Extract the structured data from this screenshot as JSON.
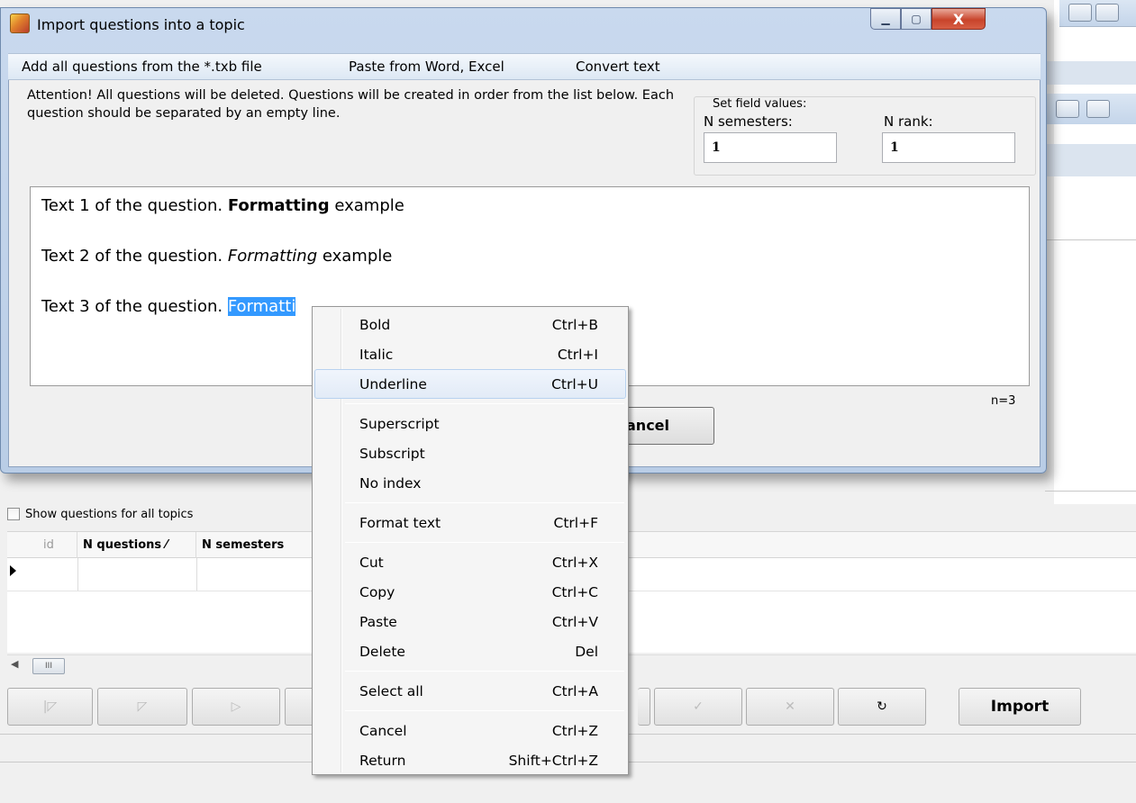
{
  "dialog": {
    "title": "Import questions into a topic",
    "close_label": "X",
    "menu": [
      "Add all questions from the *.txb file",
      "Paste from Word, Excel",
      "Convert text"
    ],
    "attention_text": "Attention! All questions will be deleted. Questions will be created in order from the list below. Each question should be separated by an empty line.",
    "field_values": {
      "legend": "Set field values:",
      "semesters_label": "N semesters:",
      "semesters_value": "1",
      "rank_label": "N rank:",
      "rank_value": "1"
    },
    "editor": {
      "lines": [
        {
          "before": "Text 1 of the question. ",
          "emph": "Formatting",
          "after": " example"
        },
        {
          "before": "Text 2 of the question. ",
          "emph": "Formatting",
          "after": " example"
        },
        {
          "before": "Text 3 of the question. ",
          "emph": "Formatti",
          "after": ""
        }
      ]
    },
    "count": "n=3",
    "cancel_label": "ancel"
  },
  "background": {
    "show_all_label": "Show questions for all topics",
    "columns": [
      "id",
      "N questions ⁄",
      "N semesters"
    ],
    "scroll_thumb": "III",
    "import_label": "Import",
    "refresh_icon": "↻"
  },
  "context_menu": {
    "items": [
      {
        "label": "Bold",
        "shortcut": "Ctrl+B"
      },
      {
        "label": "Italic",
        "shortcut": "Ctrl+I"
      },
      {
        "label": "Underline",
        "shortcut": "Ctrl+U"
      },
      {
        "label": "Superscript",
        "shortcut": ""
      },
      {
        "label": "Subscript",
        "shortcut": ""
      },
      {
        "label": "No index",
        "shortcut": ""
      },
      {
        "label": "Format text",
        "shortcut": "Ctrl+F"
      },
      {
        "label": "Cut",
        "shortcut": "Ctrl+X"
      },
      {
        "label": "Copy",
        "shortcut": "Ctrl+C"
      },
      {
        "label": "Paste",
        "shortcut": "Ctrl+V"
      },
      {
        "label": "Delete",
        "shortcut": "Del"
      },
      {
        "label": "Select all",
        "shortcut": "Ctrl+A"
      },
      {
        "label": "Cancel",
        "shortcut": "Ctrl+Z"
      },
      {
        "label": "Return",
        "shortcut": "Shift+Ctrl+Z"
      }
    ],
    "hover_item": "Underline"
  }
}
